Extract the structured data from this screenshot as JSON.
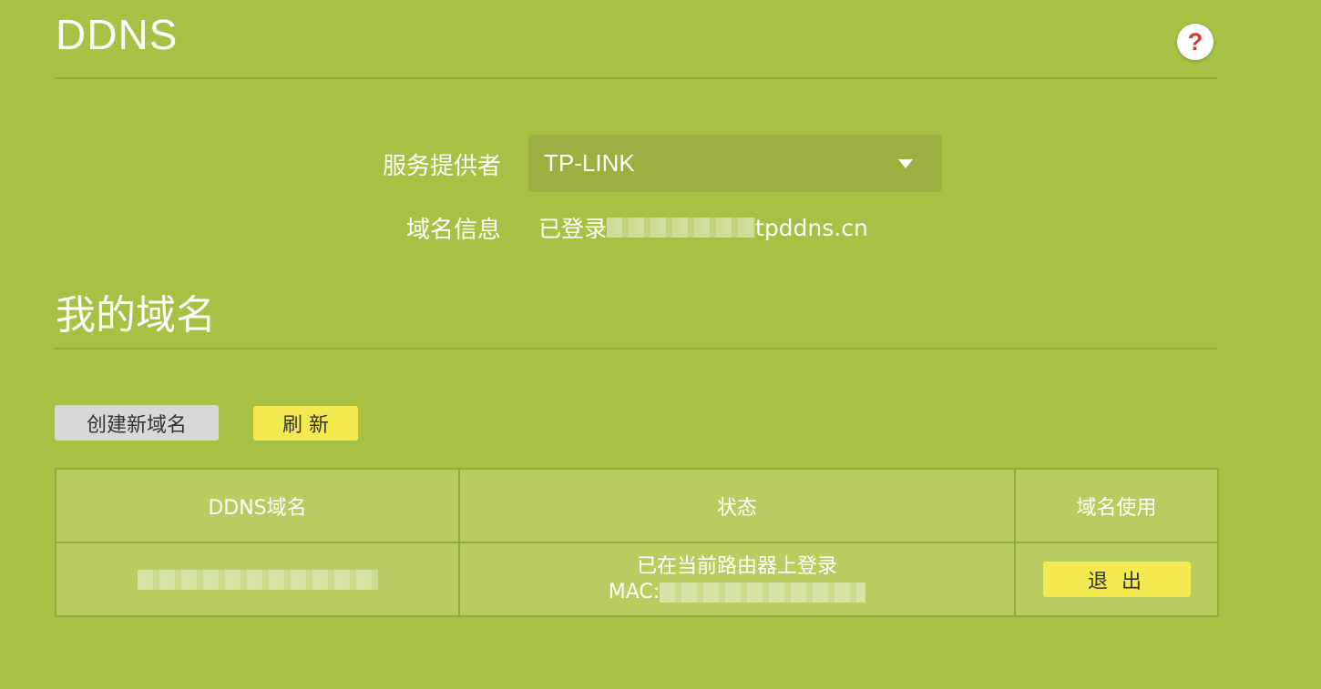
{
  "header": {
    "title": "DDNS",
    "help_icon": "?"
  },
  "form": {
    "provider_label": "服务提供者",
    "provider_value": "TP-LINK",
    "provider_icon": "chevron-down-icon",
    "domain_info_label": "域名信息",
    "domain_info_prefix": "已登录",
    "domain_info_suffix": "tpddns.cn"
  },
  "my_domains": {
    "title": "我的域名",
    "create_label": "创建新域名",
    "refresh_label": "刷 新",
    "columns": [
      "DDNS域名",
      "状态",
      "域名使用"
    ],
    "rows": [
      {
        "status_line1": "已在当前路由器上登录",
        "status_line2_prefix": "MAC:",
        "action_label": "退 出"
      }
    ]
  },
  "colors": {
    "background": "#a8c043",
    "table_cell": "#b8cc5f",
    "primary_button": "#f4e94f",
    "secondary_button": "#d7d9d6",
    "help_icon": "#d63a2c"
  }
}
